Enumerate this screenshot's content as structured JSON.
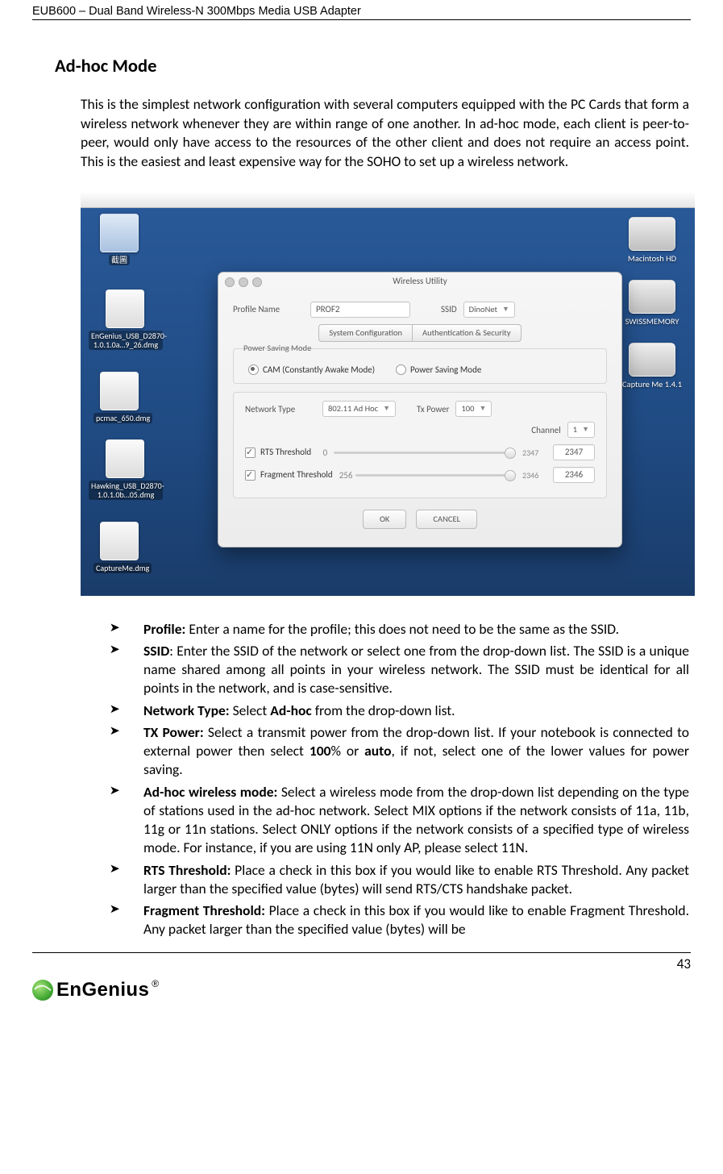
{
  "header": {
    "running": "EUB600 – Dual Band Wireless-N 300Mbps Media USB Adapter"
  },
  "section_title": "Ad-hoc Mode",
  "intro": "This is the simplest network configuration with several computers equipped with the PC Cards that form a wireless network whenever they are within range of one another.  In ad-hoc mode, each client is peer-to-peer, would only have access to the resources of the other client and does not require an access point. This is the easiest and least expensive way for the SOHO to set up a wireless network.",
  "screenshot": {
    "window_title": "Wireless Utility",
    "profile_label": "Profile Name",
    "profile_value": "PROF2",
    "ssid_label": "SSID",
    "ssid_value": "DinoNet",
    "tab1": "System Configuration",
    "tab2": "Authentication & Security",
    "psm_title": "Power Saving Mode",
    "psm_opt1": "CAM (Constantly Awake Mode)",
    "psm_opt2": "Power Saving Mode",
    "nettype_label": "Network Type",
    "nettype_value": "802.11 Ad Hoc",
    "txp_label": "Tx Power",
    "txp_value": "100",
    "chan_label": "Channel",
    "chan_value": "1",
    "rts_label": "RTS Threshold",
    "rts_min": "0",
    "rts_max": "2347",
    "rts_value": "2347",
    "frag_label": "Fragment Threshold",
    "frag_min": "256",
    "frag_max": "2346",
    "frag_value": "2346",
    "btn_ok": "OK",
    "btn_cancel": "CANCEL",
    "desktop_icons": {
      "folder": "截圖",
      "i1": "EnGenius_USB_D2870-1.0.1.0a…9_26.dmg",
      "i2": "pcmac_650.dmg",
      "i3": "Hawking_USB_D2870-1.0.1.0b…05.dmg",
      "i4": "CaptureMe.dmg",
      "d1": "Macintosh HD",
      "d2": "SWISSMEMORY",
      "d3": "Capture Me 1.4.1"
    }
  },
  "bullets": {
    "profile": {
      "term": "Profile:",
      "body": " Enter a name for the profile; this does not need to be the same as the SSID."
    },
    "ssid": {
      "term": "SSID",
      "body": ": Enter the SSID of the network or select one from the drop-down list. The SSID is a unique name shared among all points in your wireless network. The SSID must be identical for all points in the network, and is case-sensitive."
    },
    "ntype": {
      "term": "Network Type:",
      "mid": " Select ",
      "bold": "Ad-hoc",
      "tail": " from the drop-down list."
    },
    "txp": {
      "term": "TX Power:",
      "p1": " Select a transmit power from the drop-down list. If your notebook is connected to external power then select ",
      "b1": "100",
      "p2": "% or ",
      "b2": "auto",
      "p3": ", if not, select one of the lower values for power saving."
    },
    "mode": {
      "term": "Ad-hoc wireless mode:",
      "body": " Select a wireless mode from the drop-down list depending on the type of stations used in the ad-hoc network. Select MIX options if the network consists of 11a, 11b, 11g or 11n stations. Select ONLY options if the network consists of a specified type of wireless mode. For instance, if you are using 11N only AP, please select 11N."
    },
    "rts": {
      "term": "RTS Threshold:",
      "body": " Place a check in this box if you would like to enable RTS Threshold. Any packet larger than the specified value (bytes) will send RTS/CTS handshake packet."
    },
    "frag": {
      "term": "Fragment Threshold:",
      "body": " Place a check in this box if you would like to enable Fragment Threshold. Any packet larger than the specified value (bytes) will be"
    }
  },
  "page_number": "43",
  "brand": {
    "name": "EnGenius",
    "reg": "®"
  }
}
